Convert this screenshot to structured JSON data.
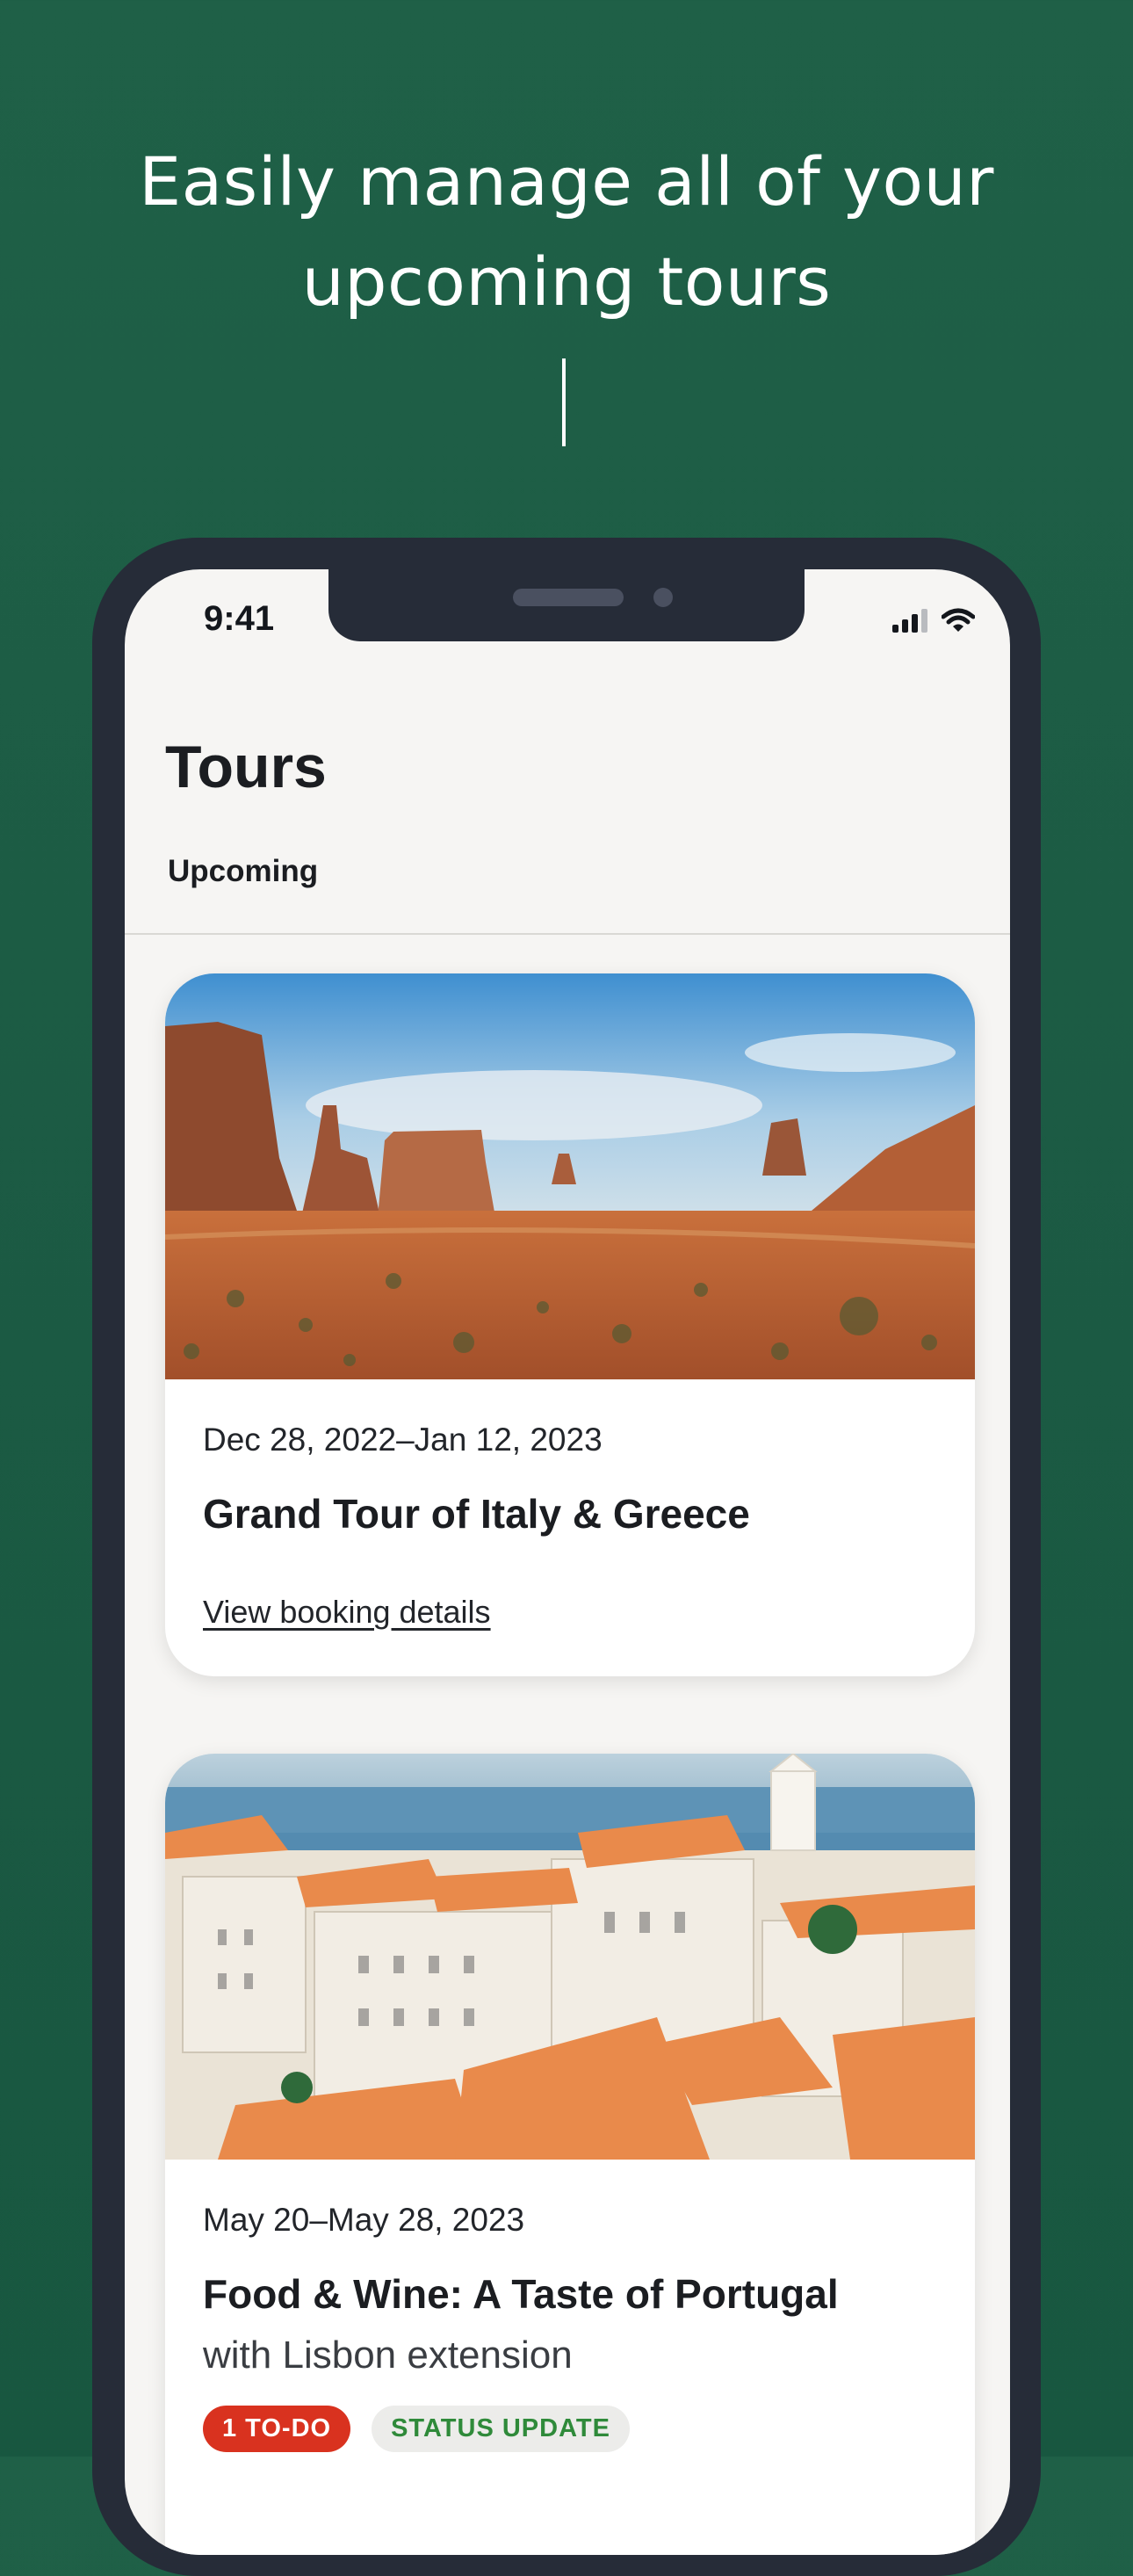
{
  "hero": {
    "headline_line1": "Easily manage all of your",
    "headline_line2": "upcoming tours"
  },
  "status_bar": {
    "time": "9:41",
    "icons": [
      "cellular-signal-icon",
      "wifi-icon"
    ]
  },
  "page": {
    "title": "Tours",
    "active_tab": "Upcoming"
  },
  "tours": [
    {
      "dates": "Dec 28, 2022–Jan 12, 2023",
      "title": "Grand Tour of Italy & Greece",
      "link": "View booking details",
      "image": "desert-canyon-landscape"
    },
    {
      "dates": "May 20–May 28, 2023",
      "title": "Food & Wine: A Taste of Portugal",
      "subtitle": "with Lisbon extension",
      "image": "lisbon-rooftops-cityscape",
      "badges": [
        "1 TO-DO",
        "STATUS UPDATE"
      ]
    }
  ],
  "colors": {
    "background": "#1d5c44",
    "phone_frame": "#262c38",
    "screen": "#f6f5f3",
    "todo_badge": "#d9321f",
    "status_badge_text": "#2f8a3a"
  }
}
